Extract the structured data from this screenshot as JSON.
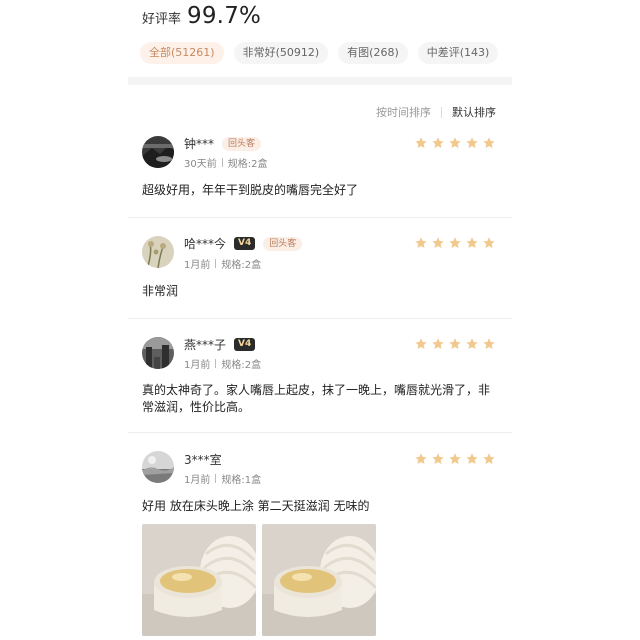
{
  "summary": {
    "label": "好评率",
    "percent": "99.7%"
  },
  "filters": [
    {
      "label": "全部(51261)",
      "active": true
    },
    {
      "label": "非常好(50912)",
      "active": false
    },
    {
      "label": "有图(268)",
      "active": false
    },
    {
      "label": "中差评(143)",
      "active": false
    }
  ],
  "sort": {
    "by_time": "按时间排序",
    "default": "默认排序"
  },
  "colors": {
    "accent": "#c8895e",
    "star": "#f2c98d",
    "chip_active_bg": "#fdf1ea"
  },
  "reviews": [
    {
      "user": "钟***",
      "badge_repeat": "回头客",
      "time": "30天前",
      "spec": "规格:2盒",
      "stars": 5,
      "text": "超级好用，年年干到脱皮的嘴唇完全好了",
      "avatar_icon": "dark-landscape-avatar"
    },
    {
      "user": "哈***今",
      "vip": "V4",
      "badge_repeat": "回头客",
      "time": "1月前",
      "spec": "规格:2盒",
      "stars": 5,
      "text": "非常润",
      "avatar_icon": "flower-avatar"
    },
    {
      "user": "燕***子",
      "vip": "V4",
      "time": "1月前",
      "spec": "规格:2盒",
      "stars": 5,
      "text": "真的太神奇了。家人嘴唇上起皮，抹了一晚上，嘴唇就光滑了，非常滋润，性价比高。",
      "avatar_icon": "street-avatar"
    },
    {
      "user": "3***室",
      "time": "1月前",
      "spec": "规格:1盒",
      "stars": 5,
      "text": "好用 放在床头晚上涂 第二天挺滋润 无味的",
      "avatar_icon": "sky-avatar"
    }
  ],
  "review_photos": [
    "lip-balm-jar-photo",
    "lip-balm-jar-photo"
  ]
}
